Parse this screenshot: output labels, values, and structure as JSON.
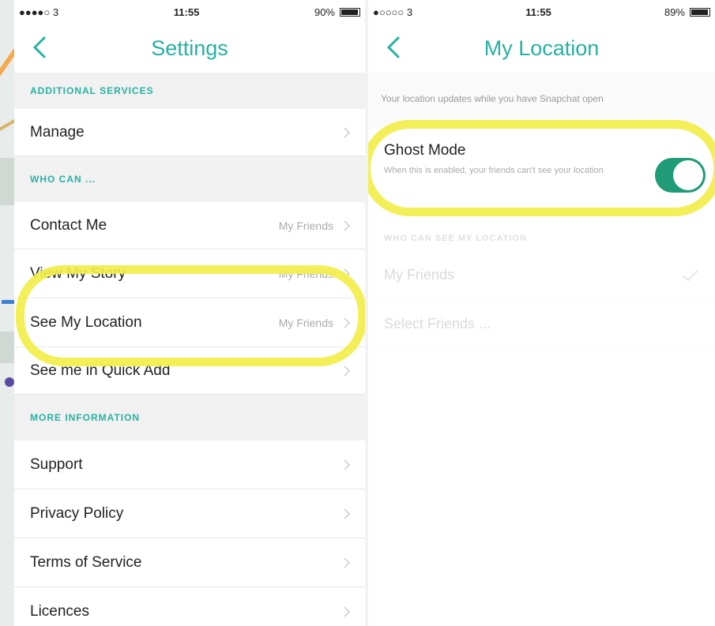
{
  "left_screen": {
    "status": {
      "signal": "●●●●○ 3",
      "time": "11:55",
      "battery": "90%",
      "battery_level": 0.9
    },
    "title": "Settings",
    "sections": [
      {
        "header": "ADDITIONAL SERVICES",
        "rows": [
          {
            "label": "Manage",
            "value": ""
          }
        ]
      },
      {
        "header": "WHO CAN ...",
        "rows": [
          {
            "label": "Contact Me",
            "value": "My Friends"
          },
          {
            "label": "View My Story",
            "value": "My Friends"
          },
          {
            "label": "See My Location",
            "value": "My Friends"
          },
          {
            "label": "See me in Quick Add",
            "value": ""
          }
        ]
      },
      {
        "header": "MORE INFORMATION",
        "rows": [
          {
            "label": "Support",
            "value": ""
          },
          {
            "label": "Privacy Policy",
            "value": ""
          },
          {
            "label": "Terms of Service",
            "value": ""
          },
          {
            "label": "Licences",
            "value": ""
          }
        ]
      }
    ]
  },
  "right_screen": {
    "status": {
      "signal": "●○○○○ 3",
      "time": "11:55",
      "battery": "89%",
      "battery_level": 0.89
    },
    "title": "My Location",
    "info": "Your location updates while you have Snapchat open",
    "ghost_mode": {
      "label": "Ghost Mode",
      "description": "When this is enabled, your friends can't see your location",
      "enabled": true
    },
    "who_can_header": "WHO CAN SEE MY LOCATION",
    "options": [
      {
        "label": "My Friends",
        "selected": true
      },
      {
        "label": "Select Friends ...",
        "selected": false
      }
    ]
  },
  "colors": {
    "accent": "#27b1a2",
    "toggle": "#1f9b77",
    "highlight": "#f2ee4a"
  },
  "icons": {
    "back": "chevron-left-icon",
    "row": "chevron-right-icon",
    "selected": "checkmark-icon"
  }
}
